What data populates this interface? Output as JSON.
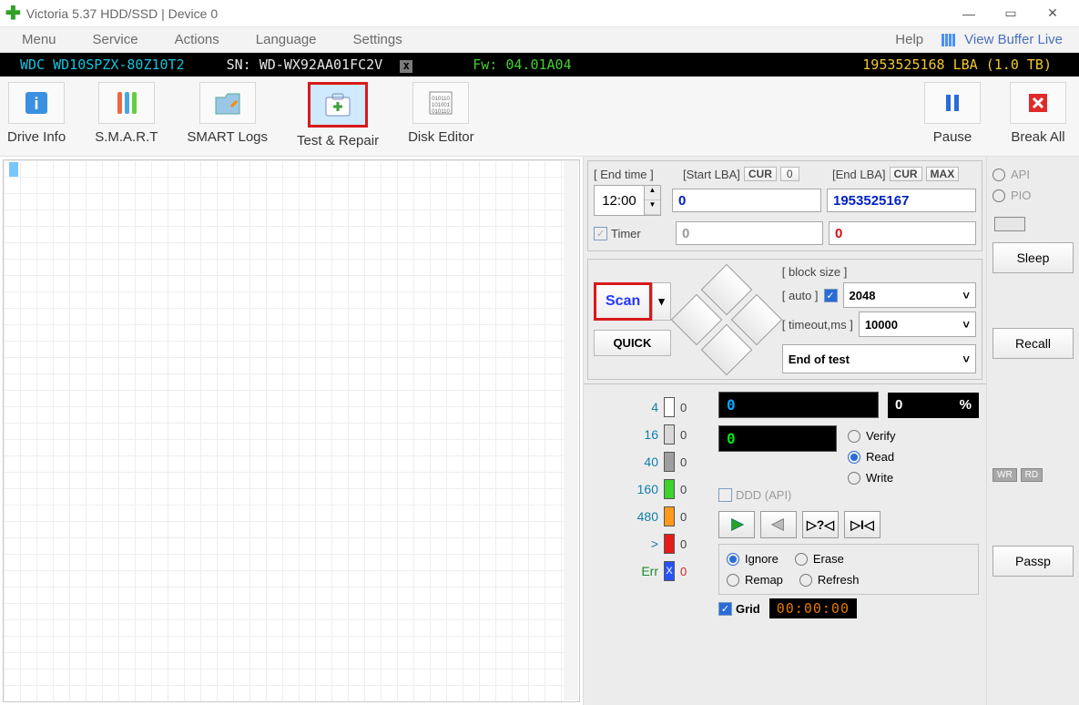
{
  "window": {
    "title": "Victoria 5.37 HDD/SSD | Device 0"
  },
  "menu": {
    "items": [
      "Menu",
      "Service",
      "Actions",
      "Language",
      "Settings",
      "Help"
    ],
    "view_buffer": "View Buffer Live"
  },
  "device": {
    "model": "WDC WD10SPZX-80Z10T2",
    "sn_label": "SN:",
    "sn": "WD-WX92AA01FC2V",
    "fw_label": "Fw:",
    "fw": "04.01A04",
    "lba": "1953525168 LBA (1.0 TB)"
  },
  "toolbar": {
    "drive_info": "Drive Info",
    "smart": "S.M.A.R.T",
    "smart_logs": "SMART Logs",
    "test_repair": "Test & Repair",
    "disk_editor": "Disk Editor",
    "pause": "Pause",
    "break_all": "Break All"
  },
  "scan": {
    "end_time_label": "[ End time ]",
    "start_lba_label": "[Start LBA]",
    "end_lba_label": "[End LBA]",
    "cur": "CUR",
    "max": "MAX",
    "end_time": "12:00",
    "start_lba": "0",
    "end_lba": "1953525167",
    "timer_label": "Timer",
    "timer_start": "0",
    "timer_end": "0",
    "scan_btn": "Scan",
    "quick_btn": "QUICK",
    "block_size_label": "[ block size ]",
    "auto_label": "[ auto ]",
    "block_size": "2048",
    "timeout_label": "[ timeout,ms ]",
    "timeout": "10000",
    "end_action": "End of test"
  },
  "legend": {
    "rows": [
      {
        "label": "4",
        "color": "#ffffff",
        "count": "0"
      },
      {
        "label": "16",
        "color": "#d8d8d8",
        "count": "0"
      },
      {
        "label": "40",
        "color": "#9e9e9e",
        "count": "0"
      },
      {
        "label": "160",
        "color": "#3ed22c",
        "count": "0"
      },
      {
        "label": "480",
        "color": "#ff9a1a",
        "count": "0"
      },
      {
        "label": ">",
        "color": "#e51a1a",
        "count": "0"
      }
    ],
    "err_label": "Err",
    "err_count": "0"
  },
  "progress": {
    "sector": "0",
    "pct_val": "0",
    "pct_sym": "%",
    "speed": "0"
  },
  "mode": {
    "verify": "Verify",
    "read": "Read",
    "write": "Write",
    "ddd": "DDD (API)"
  },
  "action_radio": {
    "ignore": "Ignore",
    "erase": "Erase",
    "remap": "Remap",
    "refresh": "Refresh"
  },
  "grid": {
    "label": "Grid",
    "time": "00:00:00"
  },
  "media_labels": {
    "seek_q": "▷?◁",
    "seek_end": "▷I◁"
  },
  "side": {
    "api": "API",
    "pio": "PIO",
    "sleep": "Sleep",
    "recall": "Recall",
    "passp": "Passp",
    "wr": "WR",
    "rd": "RD",
    "zero": "0"
  }
}
